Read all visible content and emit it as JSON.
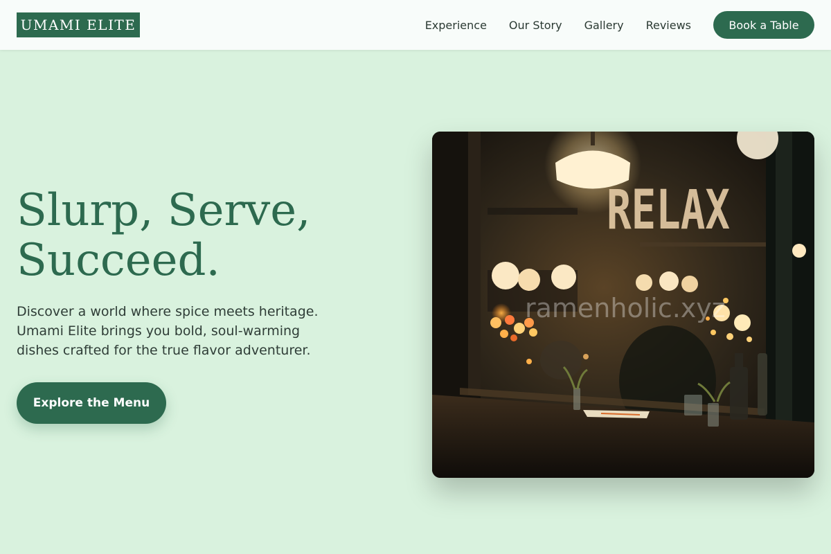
{
  "header": {
    "logo": "UMAMI ELITE",
    "nav": [
      {
        "label": "Experience"
      },
      {
        "label": "Our Story"
      },
      {
        "label": "Gallery"
      },
      {
        "label": "Reviews"
      }
    ],
    "cta_label": "Book a Table"
  },
  "hero": {
    "title_line1": "Slurp, Serve,",
    "title_line2": "Succeed.",
    "description": "Discover a world where spice meets heritage. Umami Elite brings you bold, soul-warming dishes crafted for the true flavor adventurer.",
    "cta_label": "Explore the Menu"
  },
  "photo": {
    "sign_text": "RELAX",
    "watermark": "ramenholic.xyz"
  },
  "colors": {
    "brand": "#2d6a4f",
    "page_bg": "#d9f2de",
    "header_bg": "#f8fcfa"
  }
}
